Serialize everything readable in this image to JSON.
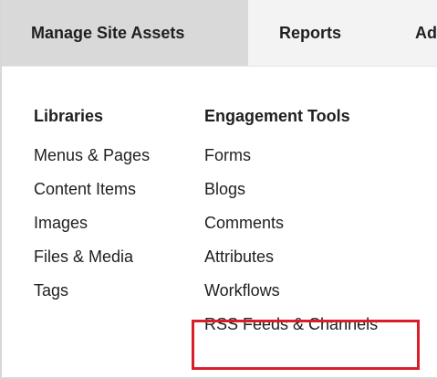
{
  "top_nav": {
    "tabs": [
      {
        "label": "Manage Site Assets",
        "active": true
      },
      {
        "label": "Reports",
        "active": false
      },
      {
        "label": "Ad",
        "active": false
      }
    ]
  },
  "menu": {
    "columns": [
      {
        "heading": "Libraries",
        "items": [
          "Menus & Pages",
          "Content Items",
          "Images",
          "Files & Media",
          "Tags"
        ]
      },
      {
        "heading": "Engagement Tools",
        "items": [
          "Forms",
          "Blogs",
          "Comments",
          "Attributes",
          "Workflows",
          "RSS Feeds & Channels"
        ]
      }
    ]
  },
  "highlight": {
    "target_label": "RSS Feeds & Channels",
    "color": "#d91e2a"
  }
}
